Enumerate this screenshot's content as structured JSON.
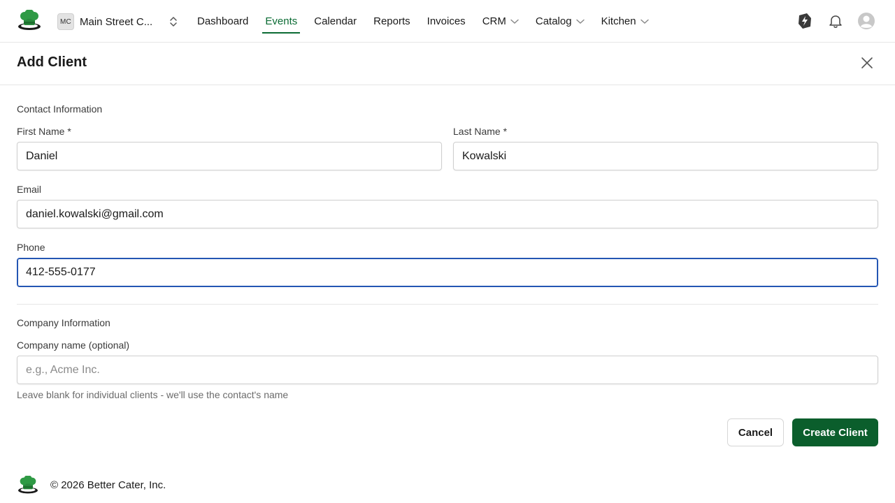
{
  "brand": {
    "logo_icon": "chef-hat-logo-icon",
    "accent": "#0b6b34",
    "primary_button": "#0b5e2c",
    "focus": "#2456b3"
  },
  "org": {
    "initials": "MC",
    "name": "Main Street C...",
    "switch_icon": "chevron-up-down-icon"
  },
  "nav": {
    "items": [
      {
        "label": "Dashboard"
      },
      {
        "label": "Events",
        "active": true
      },
      {
        "label": "Calendar"
      },
      {
        "label": "Reports"
      },
      {
        "label": "Invoices"
      },
      {
        "label": "CRM",
        "dropdown": true
      },
      {
        "label": "Catalog",
        "dropdown": true
      },
      {
        "label": "Kitchen",
        "dropdown": true
      }
    ]
  },
  "top_right": {
    "icons": [
      "lightning-tag-icon",
      "bell-icon",
      "user-avatar-icon"
    ]
  },
  "modal": {
    "title": "Add Client",
    "close_icon": "close-icon",
    "contact_section": "Contact Information",
    "first_name": {
      "label": "First Name *",
      "value": "Daniel"
    },
    "last_name": {
      "label": "Last Name *",
      "value": "Kowalski"
    },
    "email": {
      "label": "Email",
      "value": "daniel.kowalski@gmail.com"
    },
    "phone": {
      "label": "Phone",
      "value": "412-555-0177"
    },
    "company_section": "Company Information",
    "company_name": {
      "label": "Company name (optional)",
      "placeholder": "e.g., Acme Inc.",
      "hint": "Leave blank for individual clients - we'll use the contact's name"
    },
    "cancel_label": "Cancel",
    "create_label": "Create Client"
  },
  "footer": {
    "text": "© 2026 Better Cater, Inc."
  }
}
